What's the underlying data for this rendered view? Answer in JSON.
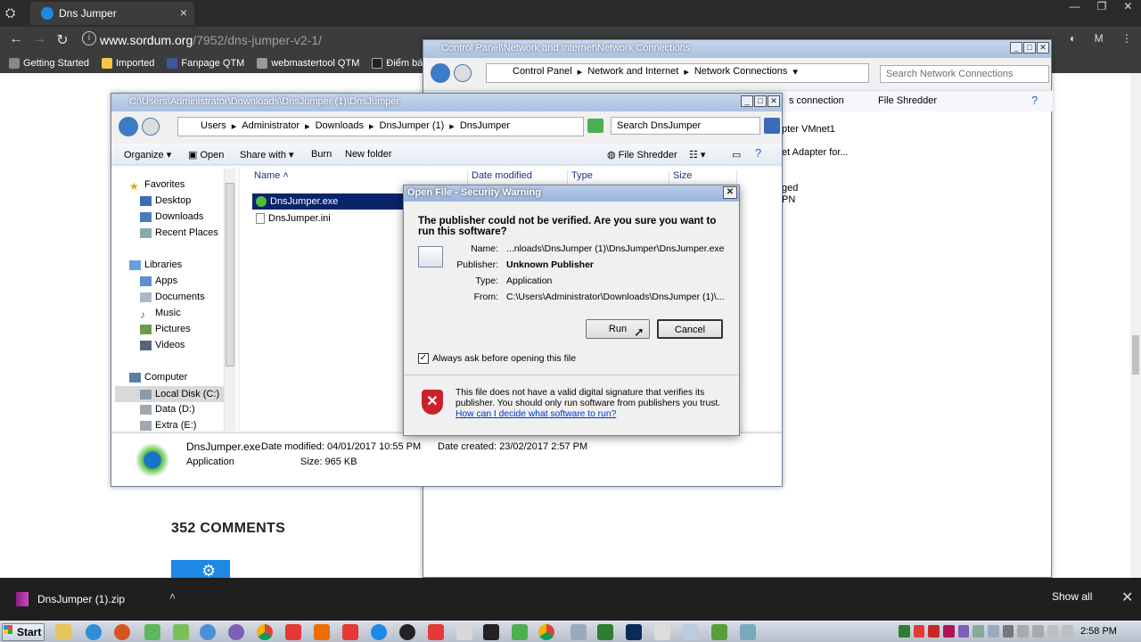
{
  "browser": {
    "tab_title": "Dns Jumper",
    "url_host": "www.sordum.org",
    "url_path": "/7952/dns-jumper-v2-1/",
    "bookmarks": [
      "Getting Started",
      "Imported",
      "Fanpage QTM",
      "webmastertool QTM",
      "Điểm báo -"
    ]
  },
  "page": {
    "comments_heading": "352 COMMENTS"
  },
  "control_panel": {
    "title": "Control Panel\\Network and Internet\\Network Connections",
    "breadcrumb": [
      "Control Panel",
      "Network and Internet",
      "Network Connections"
    ],
    "search_placeholder": "Search Network Connections",
    "toolbar_connection": "s connection",
    "toolbar_file_shredder": "File Shredder",
    "lines": [
      "pter VMnet1",
      "et Adapter for...",
      "ged",
      "PN"
    ]
  },
  "explorer": {
    "title": "C:\\Users\\Administrator\\Downloads\\DnsJumper (1)\\DnsJumper",
    "breadcrumb": [
      "Users",
      "Administrator",
      "Downloads",
      "DnsJumper (1)",
      "DnsJumper"
    ],
    "search_placeholder": "Search DnsJumper",
    "toolbar": {
      "organize": "Organize",
      "open": "Open",
      "share_with": "Share with",
      "burn": "Burn",
      "new_folder": "New folder",
      "file_shredder": "File Shredder"
    },
    "nav": {
      "favorites": "Favorites",
      "desktop": "Desktop",
      "downloads": "Downloads",
      "recent": "Recent Places",
      "libraries": "Libraries",
      "apps": "Apps",
      "documents": "Documents",
      "music": "Music",
      "pictures": "Pictures",
      "videos": "Videos",
      "computer": "Computer",
      "local_c": "Local Disk (C:)",
      "data_d": "Data (D:)",
      "extra_e": "Extra (E:)"
    },
    "columns": [
      "Name",
      "Date modified",
      "Type",
      "Size"
    ],
    "files": [
      "DnsJumper.exe",
      "DnsJumper.ini"
    ],
    "details": {
      "name": "DnsJumper.exe",
      "type": "Application",
      "date_modified": "Date modified: 04/01/2017 10:55 PM",
      "size": "Size: 965 KB",
      "date_created": "Date created: 23/02/2017 2:57 PM"
    }
  },
  "dialog": {
    "title": "Open File - Security Warning",
    "question": "The publisher could not be verified.  Are you sure you want to run this software?",
    "labels": {
      "name": "Name:",
      "publisher": "Publisher:",
      "type": "Type:",
      "from": "From:"
    },
    "values": {
      "name": "...nloads\\DnsJumper (1)\\DnsJumper\\DnsJumper.exe",
      "publisher": "Unknown Publisher",
      "type": "Application",
      "from": "C:\\Users\\Administrator\\Downloads\\DnsJumper (1)\\..."
    },
    "run": "Run",
    "cancel": "Cancel",
    "checkbox_label": "Always ask before opening this file",
    "warning": "This file does not have a valid digital signature that verifies its publisher.  You should only run software from publishers you trust.",
    "link": "How can I decide what software to run?"
  },
  "downloads": {
    "file": "DnsJumper (1).zip",
    "show_all": "Show all"
  },
  "taskbar": {
    "start": "Start",
    "clock": "2:58 PM"
  }
}
